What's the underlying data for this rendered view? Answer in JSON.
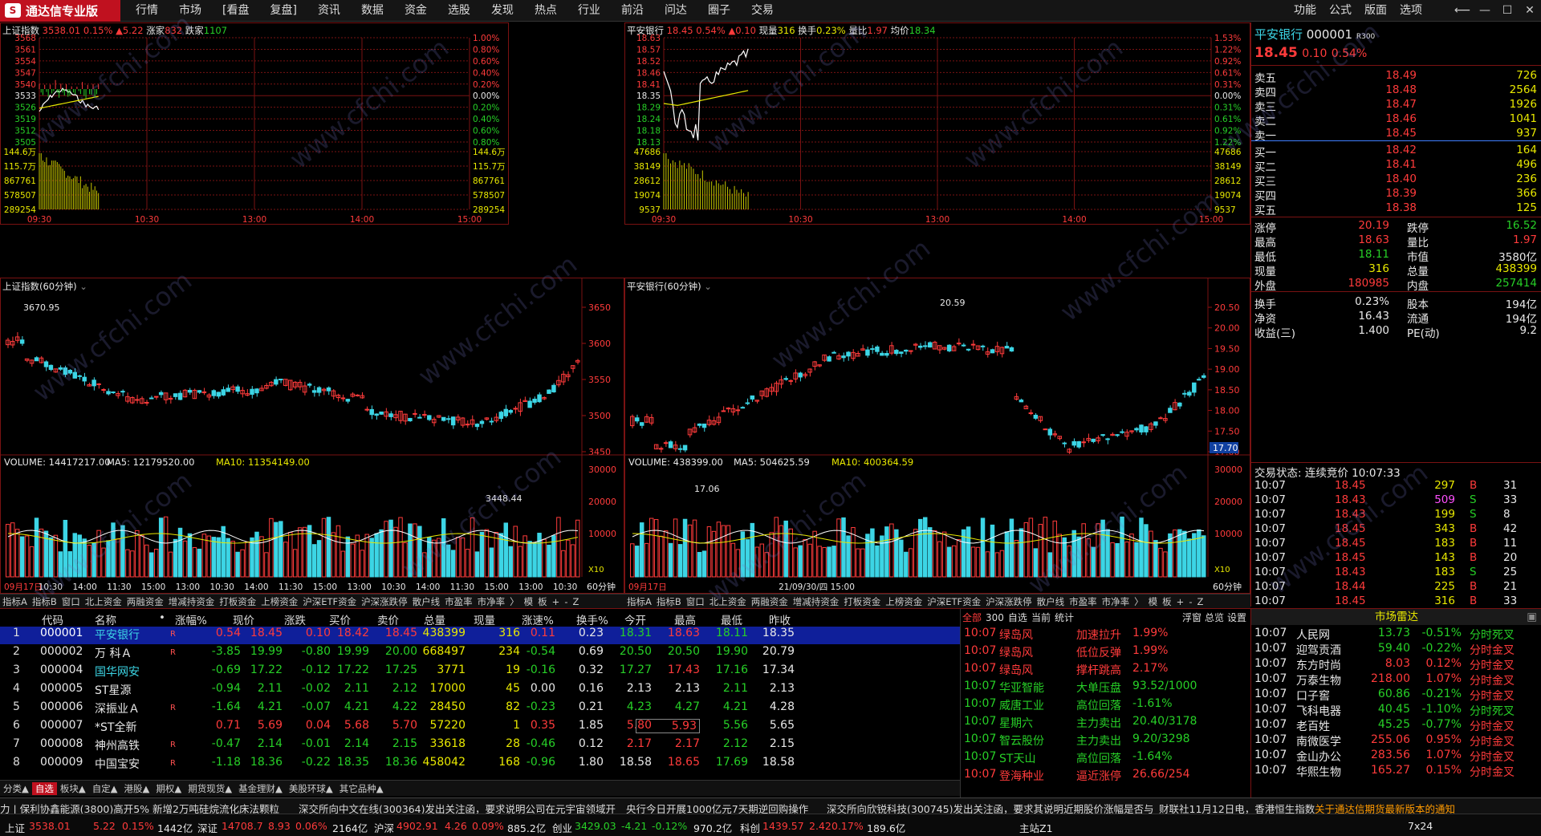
{
  "app": {
    "title": "通达信专业版",
    "logo_char": "S"
  },
  "menu": [
    "行情",
    "市场",
    "[看盘",
    "复盘]",
    "资讯",
    "数据",
    "资金",
    "选股",
    "发现",
    "热点",
    "行业",
    "前沿",
    "问达",
    "圈子",
    "交易"
  ],
  "right_menu": [
    "功能",
    "公式",
    "版面",
    "选项"
  ],
  "win_controls": [
    "⟵",
    "—",
    "☐",
    "✕"
  ],
  "panel_sh_minute": {
    "title": "上证指数",
    "price": "3538.01",
    "pct": "0.15%",
    "chg": "▲5.22",
    "up_label": "涨家",
    "up": "832",
    "down_label": "跌家",
    "down": "1107",
    "left_prices": [
      "3568",
      "3561",
      "3554",
      "3547",
      "3540",
      "3533",
      "3526",
      "3519",
      "3512",
      "3505"
    ],
    "right_pcts": [
      "1.00%",
      "0.80%",
      "0.60%",
      "0.40%",
      "0.20%",
      "0.00%",
      "0.20%",
      "0.40%",
      "0.60%",
      "0.80%"
    ],
    "vol_left": [
      "144.6万",
      "115.7万",
      "867761",
      "578507",
      "289254"
    ],
    "vol_right": [
      "144.6万",
      "115.7万",
      "867761",
      "578507",
      "289254"
    ],
    "times": [
      "09:30",
      "10:30",
      "13:00",
      "14:00",
      "15:00"
    ]
  },
  "panel_pa_minute": {
    "title": "平安银行",
    "price": "18.45",
    "pct": "0.54%",
    "chg": "▲0.10",
    "nowvol_label": "现量",
    "nowvol": "316",
    "turn_label": "换手",
    "turn": "0.23%",
    "ratio_label": "量比",
    "ratio": "1.97",
    "avg_label": "均价",
    "avg": "18.34",
    "left_prices": [
      "18.63",
      "18.57",
      "18.52",
      "18.46",
      "18.41",
      "18.35",
      "18.29",
      "18.24",
      "18.18",
      "18.13"
    ],
    "right_pcts": [
      "1.53%",
      "1.22%",
      "0.92%",
      "0.61%",
      "0.31%",
      "0.00%",
      "0.31%",
      "0.61%",
      "0.92%",
      "1.22%"
    ],
    "vol_left": [
      "47686",
      "38149",
      "28612",
      "19074",
      "9537"
    ],
    "vol_right": [
      "47686",
      "38149",
      "28612",
      "19074",
      "9537"
    ],
    "times": [
      "09:30",
      "10:30",
      "13:00",
      "14:00",
      "15:00"
    ]
  },
  "panel_sh_kline": {
    "title": "上证指数(60分钟)",
    "high_label": "3670.95",
    "low_label": "3448.44",
    "axis": [
      "3650",
      "3600",
      "3550",
      "3500",
      "3450"
    ],
    "vol_title": "VOLUME: 14417217.00",
    "ma5": "MA5: 12179520.00",
    "ma10": "MA10: 11354149.00",
    "vol_axis": [
      "30000",
      "20000",
      "10000"
    ],
    "vol_unit": "X10",
    "x_labels": [
      "09月17日",
      "10:30",
      "14:00",
      "11:30",
      "15:00",
      "13:00",
      "10:30",
      "14:00",
      "11:30",
      "15:00",
      "13:00",
      "10:30",
      "14:00",
      "11:30",
      "15:00",
      "13:00",
      "10:30"
    ],
    "period": "60分钟"
  },
  "panel_pa_kline": {
    "title": "平安银行(60分钟)",
    "high_label": "20.59",
    "low_label": "17.06",
    "axis": [
      "20.50",
      "20.00",
      "19.50",
      "19.00",
      "18.50",
      "18.00",
      "17.50",
      "17.00"
    ],
    "last_tag": "17.70",
    "vol_title": "VOLUME: 438399.00",
    "ma5": "MA5: 504625.59",
    "ma10": "MA10: 400364.59",
    "vol_axis": [
      "30000",
      "20000",
      "10000"
    ],
    "vol_unit": "X10",
    "x_labels": [
      "09月17日",
      "",
      "",
      "21/09/30/四 15:00",
      "",
      "",
      "",
      "",
      "",
      "",
      "",
      ""
    ],
    "period": "60分钟"
  },
  "tabs_left": [
    "指标A",
    "指标B",
    "窗口",
    "北上资金",
    "两融资金",
    "增减持资金",
    "打板资金",
    "上榜资金",
    "沪深ETF资金",
    "沪深涨跌停",
    "散户线",
    "市盈率",
    "市净率",
    "〉",
    "模",
    "板",
    "+",
    "-",
    "Z"
  ],
  "tabs_right": [
    "指标A",
    "指标B",
    "窗口",
    "北上资金",
    "两融资金",
    "增减持资金",
    "打板资金",
    "上榜资金",
    "沪深ETF资金",
    "沪深涨跌停",
    "散户线",
    "市盈率",
    "市净率",
    "〉",
    "模",
    "板",
    "+",
    "-",
    "Z"
  ],
  "book": {
    "name": "平安银行",
    "code": "000001",
    "tag": "R300",
    "price": "18.45",
    "chg": "0.10",
    "pct": "0.54%",
    "asks": [
      {
        "n": "卖五",
        "p": "18.49",
        "v": "726"
      },
      {
        "n": "卖四",
        "p": "18.48",
        "v": "2564"
      },
      {
        "n": "卖三",
        "p": "18.47",
        "v": "1926"
      },
      {
        "n": "卖二",
        "p": "18.46",
        "v": "1041"
      },
      {
        "n": "卖一",
        "p": "18.45",
        "v": "937"
      }
    ],
    "bids": [
      {
        "n": "买一",
        "p": "18.42",
        "v": "164"
      },
      {
        "n": "买二",
        "p": "18.41",
        "v": "496"
      },
      {
        "n": "买三",
        "p": "18.40",
        "v": "236"
      },
      {
        "n": "买四",
        "p": "18.39",
        "v": "366"
      },
      {
        "n": "买五",
        "p": "18.38",
        "v": "125"
      }
    ],
    "stats": [
      [
        "涨停",
        "20.19",
        "跌停",
        "16.52"
      ],
      [
        "最高",
        "18.63",
        "量比",
        "1.97"
      ],
      [
        "最低",
        "18.11",
        "市值",
        "3580亿"
      ],
      [
        "现量",
        "316",
        "总量",
        "438399"
      ],
      [
        "外盘",
        "180985",
        "内盘",
        "257414"
      ]
    ],
    "stats2": [
      [
        "换手",
        "0.23%",
        "股本",
        "194亿"
      ],
      [
        "净资",
        "16.43",
        "流通",
        "194亿"
      ],
      [
        "收益(三)",
        "1.400",
        "PE(动)",
        "9.2"
      ]
    ],
    "trade_status": "交易状态: 连续竞价 10:07:33",
    "ticks": [
      [
        "10:07",
        "18.45",
        "297",
        "B",
        "31"
      ],
      [
        "10:07",
        "18.43",
        "509",
        "S",
        "33"
      ],
      [
        "10:07",
        "18.43",
        "199",
        "S",
        "8"
      ],
      [
        "10:07",
        "18.45",
        "343",
        "B",
        "42"
      ],
      [
        "10:07",
        "18.45",
        "183",
        "B",
        "11"
      ],
      [
        "10:07",
        "18.45",
        "143",
        "B",
        "20"
      ],
      [
        "10:07",
        "18.43",
        "183",
        "S",
        "25"
      ],
      [
        "10:07",
        "18.44",
        "225",
        "B",
        "21"
      ],
      [
        "10:07",
        "18.45",
        "316",
        "B",
        "33"
      ]
    ]
  },
  "quotes": {
    "headers": [
      "代码",
      "名称",
      "•",
      "涨幅%",
      "现价",
      "涨跌",
      "买价",
      "卖价",
      "总量",
      "现量",
      "涨速%",
      "换手%",
      "今开",
      "最高",
      "最低",
      "昨收"
    ],
    "rows": [
      {
        "i": "1",
        "code": "000001",
        "name": "平安银行",
        "r": "R",
        "pct": "0.54",
        "price": "18.45",
        "chg": "0.10",
        "bid": "18.42",
        "ask": "18.45",
        "vol": "438399",
        "now": "316",
        "spd": "0.11",
        "turn": "0.23",
        "open": "18.31",
        "high": "18.63",
        "low": "18.11",
        "pre": "18.35"
      },
      {
        "i": "2",
        "code": "000002",
        "name": "万 科Ａ",
        "r": "R",
        "pct": "-3.85",
        "price": "19.99",
        "chg": "-0.80",
        "bid": "19.99",
        "ask": "20.00",
        "vol": "668497",
        "now": "234",
        "spd": "-0.54",
        "turn": "0.69",
        "open": "20.50",
        "high": "20.50",
        "low": "19.90",
        "pre": "20.79"
      },
      {
        "i": "3",
        "code": "000004",
        "name": "国华网安",
        "r": "",
        "pct": "-0.69",
        "price": "17.22",
        "chg": "-0.12",
        "bid": "17.22",
        "ask": "17.25",
        "vol": "3771",
        "now": "19",
        "spd": "-0.16",
        "turn": "0.32",
        "open": "17.27",
        "high": "17.43",
        "low": "17.16",
        "pre": "17.34"
      },
      {
        "i": "4",
        "code": "000005",
        "name": "ST星源",
        "r": "",
        "pct": "-0.94",
        "price": "2.11",
        "chg": "-0.02",
        "bid": "2.11",
        "ask": "2.12",
        "vol": "17000",
        "now": "45",
        "spd": "0.00",
        "turn": "0.16",
        "open": "2.13",
        "high": "2.13",
        "low": "2.11",
        "pre": "2.13"
      },
      {
        "i": "5",
        "code": "000006",
        "name": "深振业Ａ",
        "r": "R",
        "pct": "-1.64",
        "price": "4.21",
        "chg": "-0.07",
        "bid": "4.21",
        "ask": "4.22",
        "vol": "28450",
        "now": "82",
        "spd": "-0.23",
        "turn": "0.21",
        "open": "4.23",
        "high": "4.27",
        "low": "4.21",
        "pre": "4.28"
      },
      {
        "i": "6",
        "code": "000007",
        "name": "*ST全新",
        "r": "",
        "pct": "0.71",
        "price": "5.69",
        "chg": "0.04",
        "bid": "5.68",
        "ask": "5.70",
        "vol": "57220",
        "now": "1",
        "spd": "0.35",
        "turn": "1.85",
        "open": "5.80",
        "high": "5.93",
        "low": "5.56",
        "pre": "5.65"
      },
      {
        "i": "7",
        "code": "000008",
        "name": "神州高铁",
        "r": "R",
        "pct": "-0.47",
        "price": "2.14",
        "chg": "-0.01",
        "bid": "2.14",
        "ask": "2.15",
        "vol": "33618",
        "now": "28",
        "spd": "-0.46",
        "turn": "0.12",
        "open": "2.17",
        "high": "2.17",
        "low": "2.12",
        "pre": "2.15"
      },
      {
        "i": "8",
        "code": "000009",
        "name": "中国宝安",
        "r": "R",
        "pct": "-1.18",
        "price": "18.36",
        "chg": "-0.22",
        "bid": "18.35",
        "ask": "18.36",
        "vol": "458042",
        "now": "168",
        "spd": "-0.96",
        "turn": "1.80",
        "open": "18.58",
        "high": "18.65",
        "low": "17.69",
        "pre": "18.58"
      }
    ]
  },
  "quote_tabs": [
    "分类▲",
    "自选",
    "板块▲",
    "自定▲",
    "港股▲",
    "期权▲",
    "期货现货▲",
    "基金理财▲",
    "美股环球▲",
    "其它品种▲"
  ],
  "alerts": {
    "tabs": [
      "全部",
      "300",
      "自选",
      "当前",
      "统计"
    ],
    "right": [
      "浮窗",
      "总览",
      "设置"
    ],
    "rows": [
      [
        "10:07",
        "绿岛风",
        "加速拉升",
        "1.99%"
      ],
      [
        "10:07",
        "绿岛风",
        "低位反弹",
        "1.99%"
      ],
      [
        "10:07",
        "绿岛风",
        "撑杆跳高",
        "2.17%"
      ],
      [
        "10:07",
        "华亚智能",
        "大单压盘",
        "93.52/1000"
      ],
      [
        "10:07",
        "威唐工业",
        "高位回落",
        "-1.61%"
      ],
      [
        "10:07",
        "星期六",
        "主力卖出",
        "20.40/3178"
      ],
      [
        "10:07",
        "智云股份",
        "主力卖出",
        "9.20/3298"
      ],
      [
        "10:07",
        "ST天山",
        "高位回落",
        "-1.64%"
      ],
      [
        "10:07",
        "登海种业",
        "逼近涨停",
        "26.66/254"
      ]
    ]
  },
  "radar": {
    "title": "市场雷达",
    "rows": [
      [
        "10:07",
        "人民网",
        "13.73",
        "-0.51%",
        "分时死叉"
      ],
      [
        "10:07",
        "迎驾贡酒",
        "59.40",
        "-0.22%",
        "分时金叉"
      ],
      [
        "10:07",
        "东方时尚",
        "8.03",
        "0.12%",
        "分时金叉"
      ],
      [
        "10:07",
        "万泰生物",
        "218.00",
        "1.07%",
        "分时金叉"
      ],
      [
        "10:07",
        "口子窖",
        "60.86",
        "-0.21%",
        "分时金叉"
      ],
      [
        "10:07",
        "飞科电器",
        "40.45",
        "-1.10%",
        "分时死叉"
      ],
      [
        "10:07",
        "老百姓",
        "45.25",
        "-0.77%",
        "分时金叉"
      ],
      [
        "10:07",
        "南微医学",
        "255.06",
        "0.95%",
        "分时金叉"
      ],
      [
        "10:07",
        "金山办公",
        "283.56",
        "1.07%",
        "分时金叉"
      ],
      [
        "10:07",
        "华熙生物",
        "165.27",
        "0.15%",
        "分时金叉"
      ]
    ]
  },
  "ticker_items": [
    "力 | 保利协鑫能源(3800)高开5% 新增2万吨硅烷流化床法颗粒",
    "深交所向中文在线(300364)发出关注函，要求说明公司在元宇宙领域开",
    "央行今日开展1000亿元7天期逆回购操作",
    "深交所向欣锐科技(300745)发出关注函，要求其说明近期股价涨幅是否与",
    "财联社11月12日电，香港恒生指数",
    "关于通达信期货最新版本的通知"
  ],
  "status": {
    "sh_label": "上证",
    "sh": "3538.01",
    "sh_chg": "5.22",
    "sh_pct": "0.15%",
    "sh_amt": "1442亿",
    "sz_label": "深证",
    "sz": "14708.7",
    "sz_chg": "8.93",
    "sz_pct": "0.06%",
    "sz_amt": "2164亿",
    "hs_label": "沪深",
    "hs": "4902.91",
    "hs_chg": "4.26",
    "hs_pct": "0.09%",
    "hs_amt": "885.2亿",
    "cy_label": "创业",
    "cy": "3429.03",
    "cy_chg": "-4.21",
    "cy_pct": "-0.12%",
    "cy_amt": "970.2亿",
    "kc_label": "科创",
    "kc": "1439.57",
    "kc_chg": "2.42",
    "kc_pct": "0.17%",
    "kc_amt": "189.6亿",
    "site": "主站Z1",
    "mode": "7x24"
  },
  "watermark": "www.cfchi.com",
  "colors": {
    "up": "#ff3b3b",
    "down": "#27d027",
    "grid": "#7a1212",
    "accent": "#c0111f"
  }
}
